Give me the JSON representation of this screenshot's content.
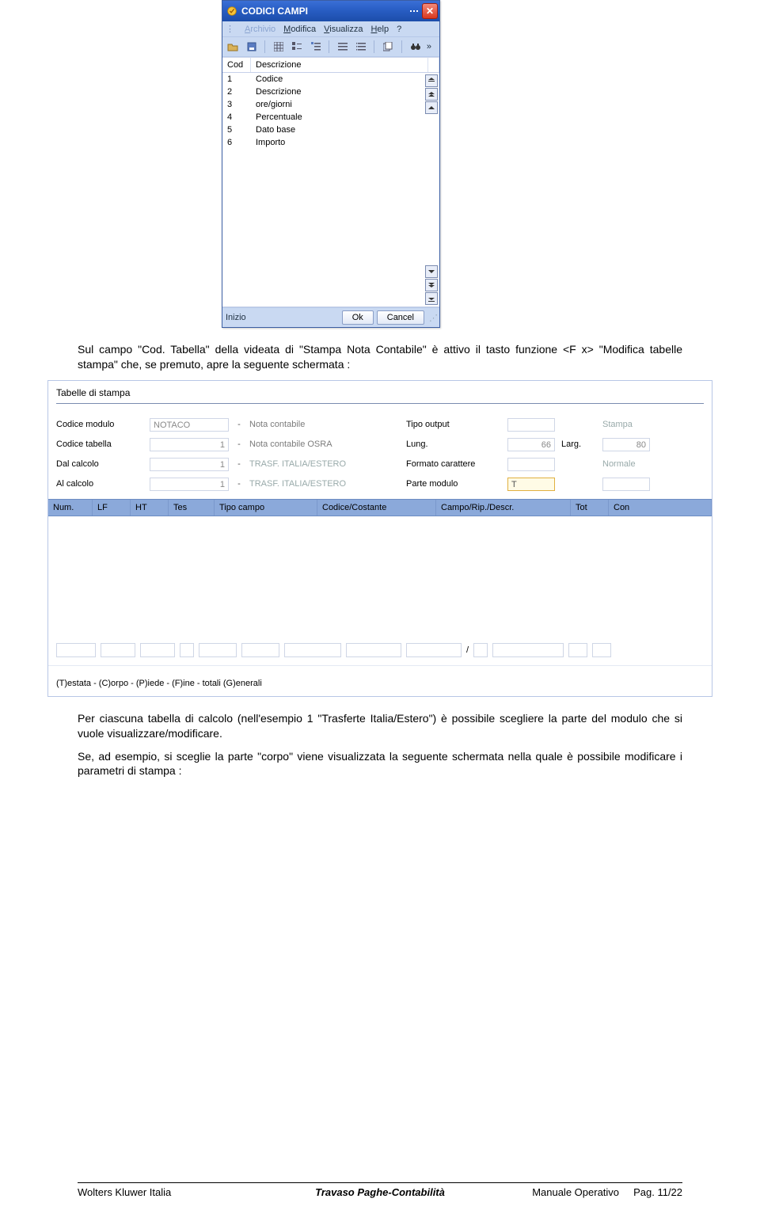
{
  "dialog": {
    "title": "CODICI CAMPI",
    "menu": {
      "archivo": "Archivio",
      "modifica": "Modifica",
      "visualizza": "Visualizza",
      "help": "Help",
      "qmark": "?"
    },
    "grid": {
      "cols": {
        "cod": "Cod",
        "desc": "Descrizione"
      },
      "rows": [
        {
          "cod": "1",
          "desc": "Codice"
        },
        {
          "cod": "2",
          "desc": "Descrizione"
        },
        {
          "cod": "3",
          "desc": "ore/giorni"
        },
        {
          "cod": "4",
          "desc": "Percentuale"
        },
        {
          "cod": "5",
          "desc": "Dato base"
        },
        {
          "cod": "6",
          "desc": "Importo"
        }
      ]
    },
    "status": {
      "label": "Inizio",
      "ok": "Ok",
      "cancel": "Cancel"
    }
  },
  "para1": "Sul campo \"Cod. Tabella\" della videata di \"Stampa Nota Contabile\" è attivo il tasto funzione <F x> \"Modifica tabelle stampa\" che, se premuto, apre la seguente schermata :",
  "form": {
    "title": "Tabelle di stampa",
    "labels": {
      "codice_modulo": "Codice modulo",
      "codice_tabella": "Codice tabella",
      "dal_calcolo": "Dal calcolo",
      "al_calcolo": "Al calcolo",
      "tipo_output": "Tipo output",
      "lung": "Lung.",
      "larg": "Larg.",
      "formato_car": "Formato carattere",
      "parte_modulo": "Parte modulo"
    },
    "values": {
      "codice_modulo_code": "NOTACO",
      "codice_modulo_desc": "Nota contabile",
      "codice_tabella_code": "1",
      "codice_tabella_desc": "Nota contabile OSRA",
      "dal_calcolo_code": "1",
      "dal_calcolo_desc": "TRASF. ITALIA/ESTERO",
      "al_calcolo_code": "1",
      "al_calcolo_desc": "TRASF. ITALIA/ESTERO",
      "tipo_output_desc": "Stampa",
      "lung_val": "66",
      "larg_val": "80",
      "formato_desc": "Normale",
      "parte_modulo_initial": "T"
    },
    "thead": {
      "num": "Num.",
      "lf": "LF",
      "ht": "HT",
      "tes": "Tes",
      "tipo_campo": "Tipo campo",
      "cod_cost": "Codice/Costante",
      "campo_rip": "Campo/Rip./Descr.",
      "tot": "Tot",
      "con": "Con"
    },
    "bottom": "(T)estata - (C)orpo - (P)iede - (F)ine - totali (G)enerali"
  },
  "para2": "Per ciascuna tabella di calcolo (nell'esempio 1 \"Trasferte Italia/Estero\") è possibile scegliere la parte del modulo che si vuole visualizzare/modificare.",
  "para3": "Se, ad esempio, si sceglie la parte \"corpo\" viene visualizzata la seguente schermata nella quale è possibile modificare i parametri di stampa :",
  "footer": {
    "left": "Wolters Kluwer Italia",
    "center": "Travaso Paghe-Contabilità",
    "right_label": "Manuale Operativo",
    "right_page": "Pag.   11/22"
  }
}
